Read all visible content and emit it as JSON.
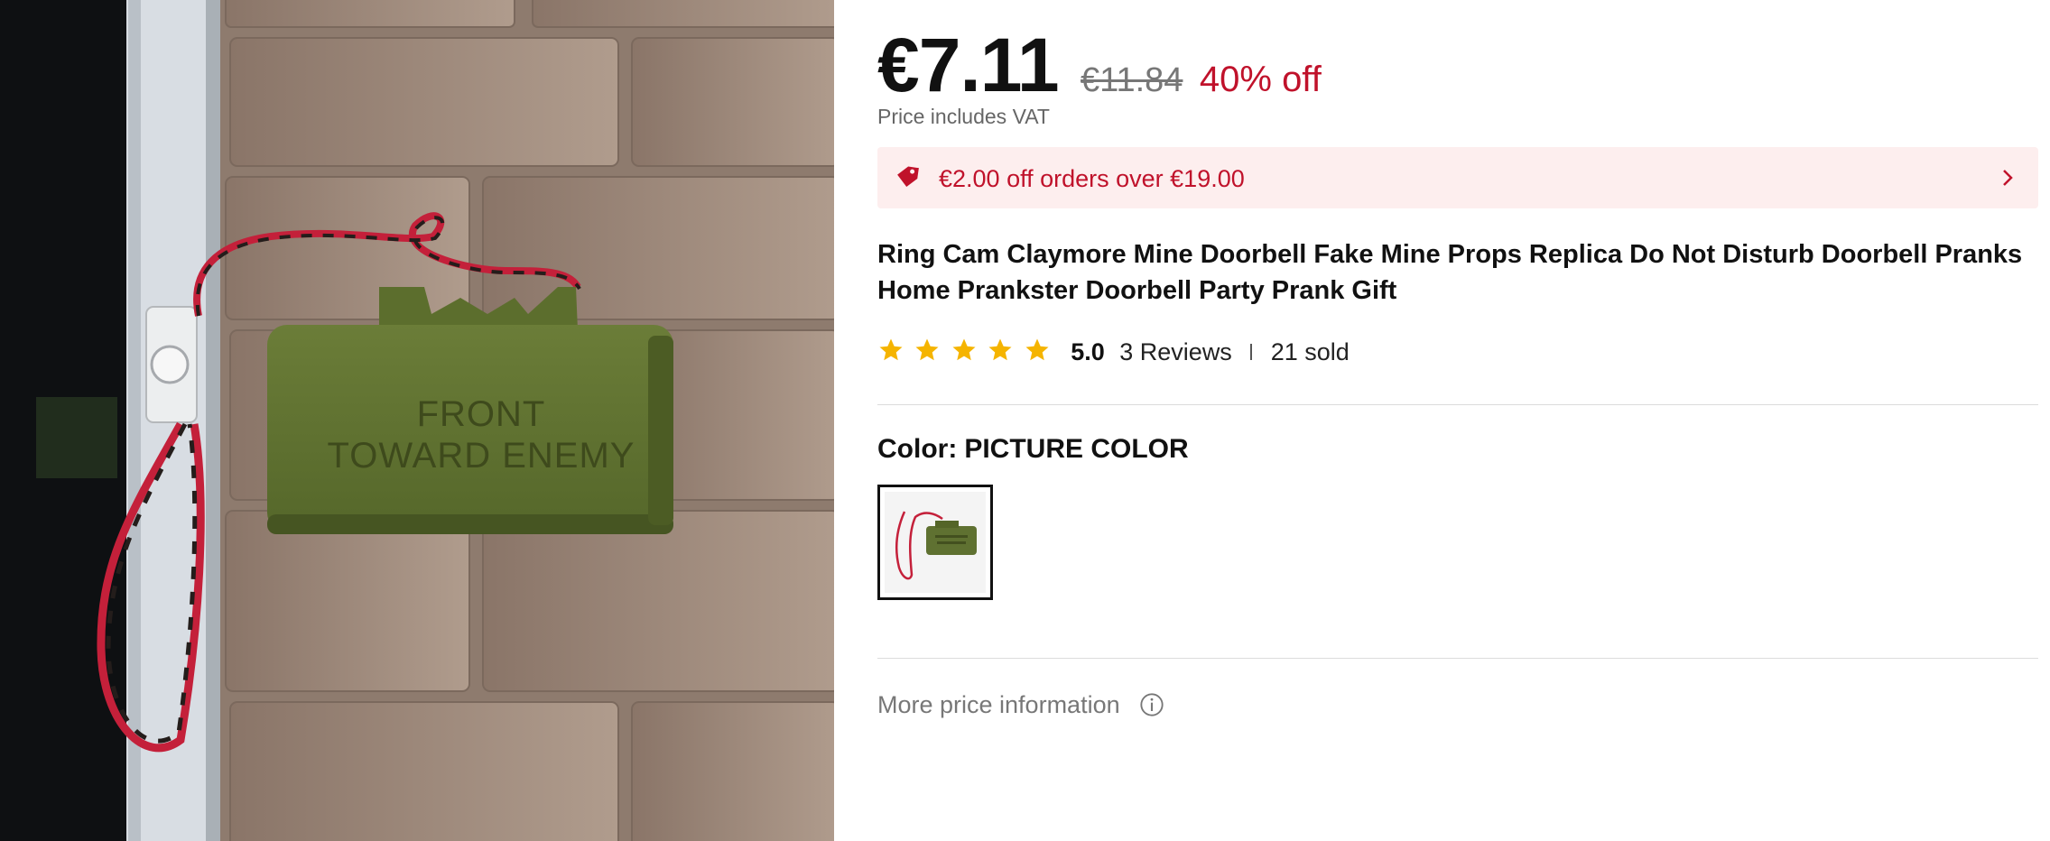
{
  "product_image": {
    "alt": "Claymore mine doorbell prop mounted on brick wall",
    "embossed_text": [
      "FRONT",
      "TOWARD ENEMY"
    ]
  },
  "price": {
    "current": "€7.11",
    "original": "€11.84",
    "discount": "40% off",
    "vat_note": "Price includes VAT"
  },
  "promo": {
    "icon": "tag-icon",
    "text": "€2.00 off orders over €19.00",
    "action_icon": "chevron-right-icon"
  },
  "title": "Ring Cam Claymore Mine Doorbell Fake Mine Props Replica Do Not Disturb Doorbell Pranks Home Prankster Doorbell Party Prank Gift",
  "rating": {
    "stars": 5,
    "score": "5.0",
    "reviews": "3 Reviews",
    "sold": "21 sold"
  },
  "color": {
    "label": "Color:",
    "value": "PICTURE COLOR"
  },
  "more_info": {
    "label": "More price information",
    "icon": "info-icon"
  },
  "colors": {
    "accent_red": "#c0122b",
    "promo_bg": "#fdeeee",
    "star_yellow": "#f5b400",
    "mine_green": "#5f7131"
  }
}
